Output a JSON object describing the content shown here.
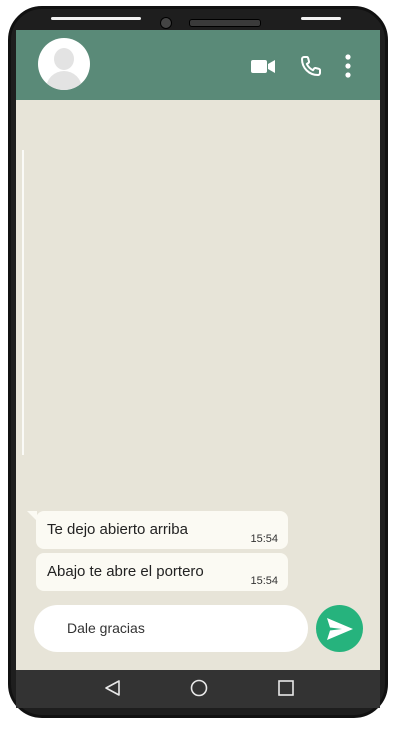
{
  "header": {
    "avatar_icon": "user-avatar-icon",
    "actions": [
      {
        "name": "video-call",
        "icon": "video-camera-icon"
      },
      {
        "name": "voice-call",
        "icon": "phone-icon"
      },
      {
        "name": "more-options",
        "icon": "three-dots-vertical-icon"
      }
    ]
  },
  "messages": [
    {
      "text": "Te dejo abierto arriba",
      "time": "15:54"
    },
    {
      "text": "Abajo te abre el portero",
      "time": "15:54"
    }
  ],
  "composer": {
    "value": "Dale gracias",
    "send_icon": "send-arrow-icon"
  },
  "nav": {
    "icons": [
      "back-triangle-icon",
      "home-circle-icon",
      "recents-square-icon"
    ]
  },
  "colors": {
    "header_bg": "#5a8a78",
    "chat_bg": "#e7e4d8",
    "bubble_bg": "#fbfaf3",
    "send_bg": "#26b37d",
    "nav_bg": "#333333",
    "phone_frame": "#1e1e1e"
  }
}
